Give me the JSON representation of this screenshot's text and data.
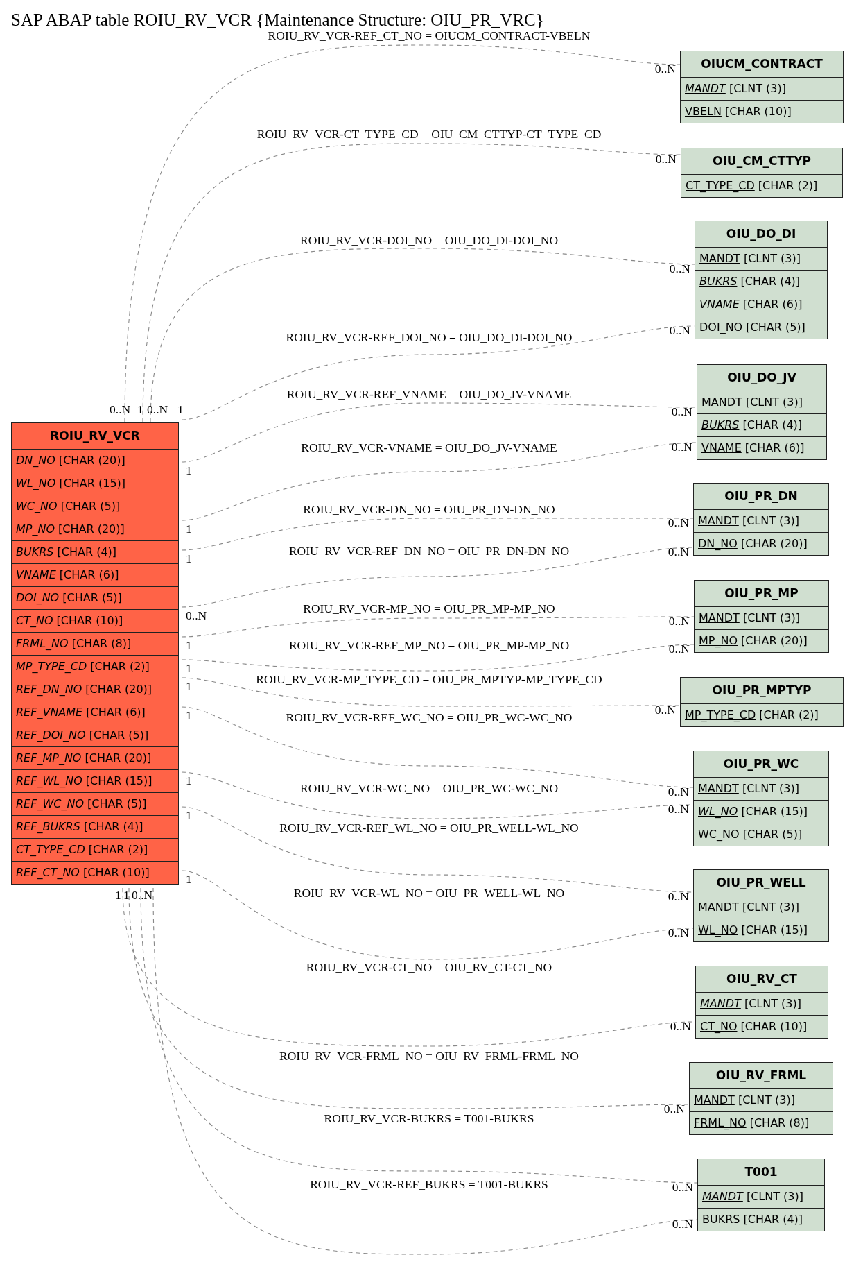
{
  "title": "SAP ABAP table ROIU_RV_VCR {Maintenance Structure: OIU_PR_VRC}",
  "main_table": {
    "name": "ROIU_RV_VCR",
    "fields": [
      {
        "name": "DN_NO",
        "type": "[CHAR (20)]",
        "key": false,
        "foreign_key": true
      },
      {
        "name": "WL_NO",
        "type": "[CHAR (15)]",
        "key": false,
        "foreign_key": true
      },
      {
        "name": "WC_NO",
        "type": "[CHAR (5)]",
        "key": false,
        "foreign_key": true
      },
      {
        "name": "MP_NO",
        "type": "[CHAR (20)]",
        "key": false,
        "foreign_key": true
      },
      {
        "name": "BUKRS",
        "type": "[CHAR (4)]",
        "key": false,
        "foreign_key": true
      },
      {
        "name": "VNAME",
        "type": "[CHAR (6)]",
        "key": false,
        "foreign_key": true
      },
      {
        "name": "DOI_NO",
        "type": "[CHAR (5)]",
        "key": false,
        "foreign_key": true
      },
      {
        "name": "CT_NO",
        "type": "[CHAR (10)]",
        "key": false,
        "foreign_key": true
      },
      {
        "name": "FRML_NO",
        "type": "[CHAR (8)]",
        "key": false,
        "foreign_key": true
      },
      {
        "name": "MP_TYPE_CD",
        "type": "[CHAR (2)]",
        "key": false,
        "foreign_key": true
      },
      {
        "name": "REF_DN_NO",
        "type": "[CHAR (20)]",
        "key": false,
        "foreign_key": true
      },
      {
        "name": "REF_VNAME",
        "type": "[CHAR (6)]",
        "key": false,
        "foreign_key": true
      },
      {
        "name": "REF_DOI_NO",
        "type": "[CHAR (5)]",
        "key": false,
        "foreign_key": true
      },
      {
        "name": "REF_MP_NO",
        "type": "[CHAR (20)]",
        "key": false,
        "foreign_key": true
      },
      {
        "name": "REF_WL_NO",
        "type": "[CHAR (15)]",
        "key": false,
        "foreign_key": true
      },
      {
        "name": "REF_WC_NO",
        "type": "[CHAR (5)]",
        "key": false,
        "foreign_key": true
      },
      {
        "name": "REF_BUKRS",
        "type": "[CHAR (4)]",
        "key": false,
        "foreign_key": true
      },
      {
        "name": "CT_TYPE_CD",
        "type": "[CHAR (2)]",
        "key": false,
        "foreign_key": true
      },
      {
        "name": "REF_CT_NO",
        "type": "[CHAR (10)]",
        "key": false,
        "foreign_key": true
      }
    ]
  },
  "related_tables": [
    {
      "name": "OIUCM_CONTRACT",
      "fields": [
        {
          "name": "MANDT",
          "type": "[CLNT (3)]",
          "key": true,
          "foreign_key": true
        },
        {
          "name": "VBELN",
          "type": "[CHAR (10)]",
          "key": true,
          "foreign_key": false
        }
      ]
    },
    {
      "name": "OIU_CM_CTTYP",
      "fields": [
        {
          "name": "CT_TYPE_CD",
          "type": "[CHAR (2)]",
          "key": true,
          "foreign_key": false
        }
      ]
    },
    {
      "name": "OIU_DO_DI",
      "fields": [
        {
          "name": "MANDT",
          "type": "[CLNT (3)]",
          "key": true,
          "foreign_key": false
        },
        {
          "name": "BUKRS",
          "type": "[CHAR (4)]",
          "key": true,
          "foreign_key": true
        },
        {
          "name": "VNAME",
          "type": "[CHAR (6)]",
          "key": true,
          "foreign_key": true
        },
        {
          "name": "DOI_NO",
          "type": "[CHAR (5)]",
          "key": true,
          "foreign_key": false
        }
      ]
    },
    {
      "name": "OIU_DO_JV",
      "fields": [
        {
          "name": "MANDT",
          "type": "[CLNT (3)]",
          "key": true,
          "foreign_key": false
        },
        {
          "name": "BUKRS",
          "type": "[CHAR (4)]",
          "key": true,
          "foreign_key": true
        },
        {
          "name": "VNAME",
          "type": "[CHAR (6)]",
          "key": true,
          "foreign_key": false
        }
      ]
    },
    {
      "name": "OIU_PR_DN",
      "fields": [
        {
          "name": "MANDT",
          "type": "[CLNT (3)]",
          "key": true,
          "foreign_key": false
        },
        {
          "name": "DN_NO",
          "type": "[CHAR (20)]",
          "key": true,
          "foreign_key": false
        }
      ]
    },
    {
      "name": "OIU_PR_MP",
      "fields": [
        {
          "name": "MANDT",
          "type": "[CLNT (3)]",
          "key": true,
          "foreign_key": false
        },
        {
          "name": "MP_NO",
          "type": "[CHAR (20)]",
          "key": true,
          "foreign_key": false
        }
      ]
    },
    {
      "name": "OIU_PR_MPTYP",
      "fields": [
        {
          "name": "MP_TYPE_CD",
          "type": "[CHAR (2)]",
          "key": true,
          "foreign_key": false
        }
      ]
    },
    {
      "name": "OIU_PR_WC",
      "fields": [
        {
          "name": "MANDT",
          "type": "[CLNT (3)]",
          "key": true,
          "foreign_key": false
        },
        {
          "name": "WL_NO",
          "type": "[CHAR (15)]",
          "key": true,
          "foreign_key": true
        },
        {
          "name": "WC_NO",
          "type": "[CHAR (5)]",
          "key": true,
          "foreign_key": false
        }
      ]
    },
    {
      "name": "OIU_PR_WELL",
      "fields": [
        {
          "name": "MANDT",
          "type": "[CLNT (3)]",
          "key": true,
          "foreign_key": false
        },
        {
          "name": "WL_NO",
          "type": "[CHAR (15)]",
          "key": true,
          "foreign_key": false
        }
      ]
    },
    {
      "name": "OIU_RV_CT",
      "fields": [
        {
          "name": "MANDT",
          "type": "[CLNT (3)]",
          "key": true,
          "foreign_key": true
        },
        {
          "name": "CT_NO",
          "type": "[CHAR (10)]",
          "key": true,
          "foreign_key": false
        }
      ]
    },
    {
      "name": "OIU_RV_FRML",
      "fields": [
        {
          "name": "MANDT",
          "type": "[CLNT (3)]",
          "key": true,
          "foreign_key": false
        },
        {
          "name": "FRML_NO",
          "type": "[CHAR (8)]",
          "key": true,
          "foreign_key": false
        }
      ]
    },
    {
      "name": "T001",
      "fields": [
        {
          "name": "MANDT",
          "type": "[CLNT (3)]",
          "key": true,
          "foreign_key": true
        },
        {
          "name": "BUKRS",
          "type": "[CHAR (4)]",
          "key": true,
          "foreign_key": false
        }
      ]
    }
  ],
  "relations": [
    {
      "label": "ROIU_RV_VCR-REF_CT_NO = OIUCM_CONTRACT-VBELN",
      "source_cardinality": "0..N",
      "target_cardinality": "0..N"
    },
    {
      "label": "ROIU_RV_VCR-CT_TYPE_CD = OIU_CM_CTTYP-CT_TYPE_CD",
      "source_cardinality": "1",
      "target_cardinality": "0..N"
    },
    {
      "label": "ROIU_RV_VCR-DOI_NO = OIU_DO_DI-DOI_NO",
      "source_cardinality": "0..N",
      "target_cardinality": "0..N"
    },
    {
      "label": "ROIU_RV_VCR-REF_DOI_NO = OIU_DO_DI-DOI_NO",
      "source_cardinality": "1",
      "target_cardinality": "0..N"
    },
    {
      "label": "ROIU_RV_VCR-REF_VNAME = OIU_DO_JV-VNAME",
      "source_cardinality": "1",
      "target_cardinality": "0..N"
    },
    {
      "label": "ROIU_RV_VCR-VNAME = OIU_DO_JV-VNAME",
      "source_cardinality": "1",
      "target_cardinality": "0..N"
    },
    {
      "label": "ROIU_RV_VCR-DN_NO = OIU_PR_DN-DN_NO",
      "source_cardinality": "1",
      "target_cardinality": "0..N"
    },
    {
      "label": "ROIU_RV_VCR-REF_DN_NO = OIU_PR_DN-DN_NO",
      "source_cardinality": "0..N",
      "target_cardinality": "0..N"
    },
    {
      "label": "ROIU_RV_VCR-MP_NO = OIU_PR_MP-MP_NO",
      "source_cardinality": "1",
      "target_cardinality": "0..N"
    },
    {
      "label": "ROIU_RV_VCR-REF_MP_NO = OIU_PR_MP-MP_NO",
      "source_cardinality": "1",
      "target_cardinality": "0..N"
    },
    {
      "label": "ROIU_RV_VCR-MP_TYPE_CD = OIU_PR_MPTYP-MP_TYPE_CD",
      "source_cardinality": "1",
      "target_cardinality": "0..N"
    },
    {
      "label": "ROIU_RV_VCR-REF_WC_NO = OIU_PR_WC-WC_NO",
      "source_cardinality": "1",
      "target_cardinality": "0..N"
    },
    {
      "label": "ROIU_RV_VCR-WC_NO = OIU_PR_WC-WC_NO",
      "source_cardinality": "1",
      "target_cardinality": "0..N"
    },
    {
      "label": "ROIU_RV_VCR-REF_WL_NO = OIU_PR_WELL-WL_NO",
      "source_cardinality": "1",
      "target_cardinality": "0..N"
    },
    {
      "label": "ROIU_RV_VCR-WL_NO = OIU_PR_WELL-WL_NO",
      "source_cardinality": "1",
      "target_cardinality": "0..N"
    },
    {
      "label": "ROIU_RV_VCR-CT_NO = OIU_RV_CT-CT_NO",
      "source_cardinality": "1",
      "target_cardinality": "0..N"
    },
    {
      "label": "ROIU_RV_VCR-FRML_NO = OIU_RV_FRML-FRML_NO",
      "source_cardinality": "1",
      "target_cardinality": "0..N"
    },
    {
      "label": "ROIU_RV_VCR-BUKRS = T001-BUKRS",
      "source_cardinality": "0..N",
      "target_cardinality": "0..N"
    },
    {
      "label": "ROIU_RV_VCR-REF_BUKRS = T001-BUKRS",
      "target_cardinality": "0..N"
    }
  ]
}
